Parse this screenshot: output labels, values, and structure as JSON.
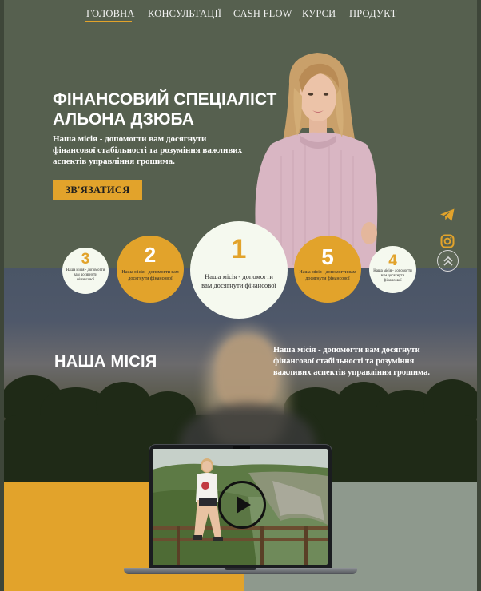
{
  "nav": {
    "items": [
      "ГОЛОВНА",
      "КОНСУЛЬТАЦІЇ",
      "CASH FLOW",
      "КУРСИ",
      "ПРОДУКТ"
    ],
    "active_index": 0
  },
  "hero": {
    "title_line1": "ФІНАНСОВИЙ СПЕЦІАЛІСТ",
    "title_line2": "АЛЬОНА ДЗЮБА",
    "description": "Наша місія - допомогти вам досягнути фінансової стабільності та розуміння важливих аспектів управління грошима.",
    "cta_label": "ЗВ'ЯЗАТИСЯ"
  },
  "circles": [
    {
      "number": "3",
      "text": "Наша місія - допомогти вам досягнути фінансової"
    },
    {
      "number": "2",
      "text": "Наша місія - допомогти вам досягнути фінансової"
    },
    {
      "number": "1",
      "text": "Наша місія - допомогти вам досягнути фінансової"
    },
    {
      "number": "5",
      "text": "Наша місія - допомогти вам досягнути фінансової"
    },
    {
      "number": "4",
      "text": "Наша місія - допомогти вам досягнути фінансової"
    }
  ],
  "mission": {
    "title": "НАША МІСІЯ",
    "description": "Наша місія - допомогти вам досягнути фінансової стабільності та розуміння важливих аспектів управління грошима."
  },
  "side_icons": [
    "telegram-icon",
    "instagram-icon",
    "scroll-up-icon"
  ],
  "colors": {
    "accent": "#e2a32b",
    "hero_bg": "#56604f",
    "circle_light": "#f5f9ef",
    "block_gray": "#8e998d"
  }
}
